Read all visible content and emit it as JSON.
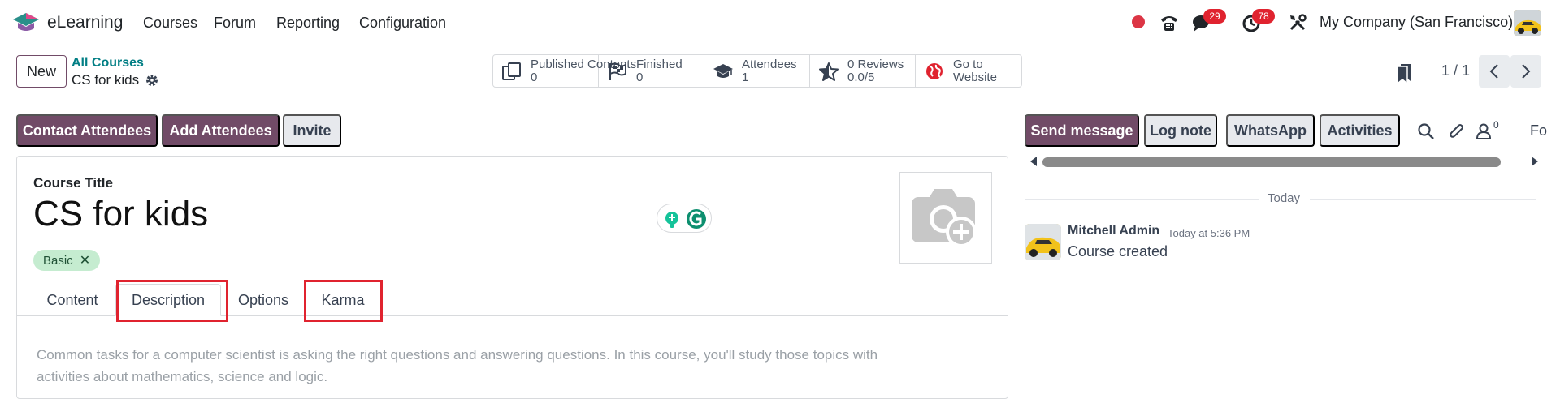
{
  "navbar": {
    "app_name": "eLearning",
    "menu": [
      "Courses",
      "Forum",
      "Reporting",
      "Configuration"
    ],
    "messages_count": "29",
    "activities_count": "78",
    "company": "My Company (San Francisco)"
  },
  "control_panel": {
    "new_label": "New",
    "breadcrumb_parent": "All Courses",
    "breadcrumb_current": "CS for kids",
    "stats": [
      {
        "label": "Published Contents",
        "value": "0",
        "icon": "published-contents-icon"
      },
      {
        "label": "Finished",
        "value": "0",
        "icon": "checkered-flag-icon"
      },
      {
        "label": "Attendees",
        "value": "1",
        "icon": "graduation-cap-icon"
      },
      {
        "label": "0 Reviews",
        "value": "0.0/5",
        "icon": "star-icon"
      },
      {
        "label": "Go to",
        "value": "Website",
        "icon": "globe-icon"
      }
    ],
    "pager": "1 / 1"
  },
  "actions": {
    "contact_attendees": "Contact Attendees",
    "add_attendees": "Add Attendees",
    "invite": "Invite"
  },
  "form": {
    "course_title_label": "Course Title",
    "course_title": "CS for kids",
    "tag": "Basic",
    "tabs": [
      "Content",
      "Description",
      "Options",
      "Karma"
    ],
    "active_tab": "Description",
    "description_line1": "Common tasks for a computer scientist is asking the right questions and answering questions. In this course, you'll study those topics with",
    "description_line2": "activities about mathematics, science and logic."
  },
  "chatter": {
    "send_message": "Send message",
    "log_note": "Log note",
    "whatsapp": "WhatsApp",
    "activities": "Activities",
    "followers_count": "0",
    "follow_label": "Fo",
    "date_separator": "Today",
    "message": {
      "author": "Mitchell Admin",
      "time": "Today at 5:36 PM",
      "body": "Course created"
    }
  },
  "colors": {
    "brand": "#714b67",
    "link": "#017e84",
    "highlight": "#e0232f",
    "tag_bg": "#c5ecd0"
  }
}
